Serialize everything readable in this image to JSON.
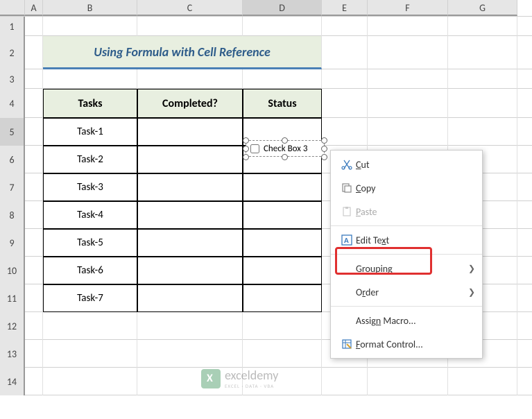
{
  "columns": [
    "A",
    "B",
    "C",
    "D",
    "E",
    "F",
    "G"
  ],
  "rows": [
    "1",
    "2",
    "3",
    "4",
    "5",
    "6",
    "7",
    "8",
    "9",
    "10",
    "11",
    "12",
    "13",
    "14"
  ],
  "title": "Using Formula with Cell Reference",
  "table": {
    "headers": {
      "tasks": "Tasks",
      "completed": "Completed?",
      "status": "Status"
    },
    "tasks": [
      "Task-1",
      "Task-2",
      "Task-3",
      "Task-4",
      "Task-5",
      "Task-6",
      "Task-7"
    ]
  },
  "checkbox": {
    "label": "Check Box 3"
  },
  "menu": {
    "cut": "Cut",
    "copy": "Copy",
    "paste": "Paste",
    "edit_text": "Edit Text",
    "grouping": "Grouping",
    "order": "Order",
    "assign_macro": "Assign Macro...",
    "format_control": "Format Control..."
  },
  "watermark": {
    "brand": "exceldemy",
    "sub": "EXCEL · DATA · VBA"
  }
}
